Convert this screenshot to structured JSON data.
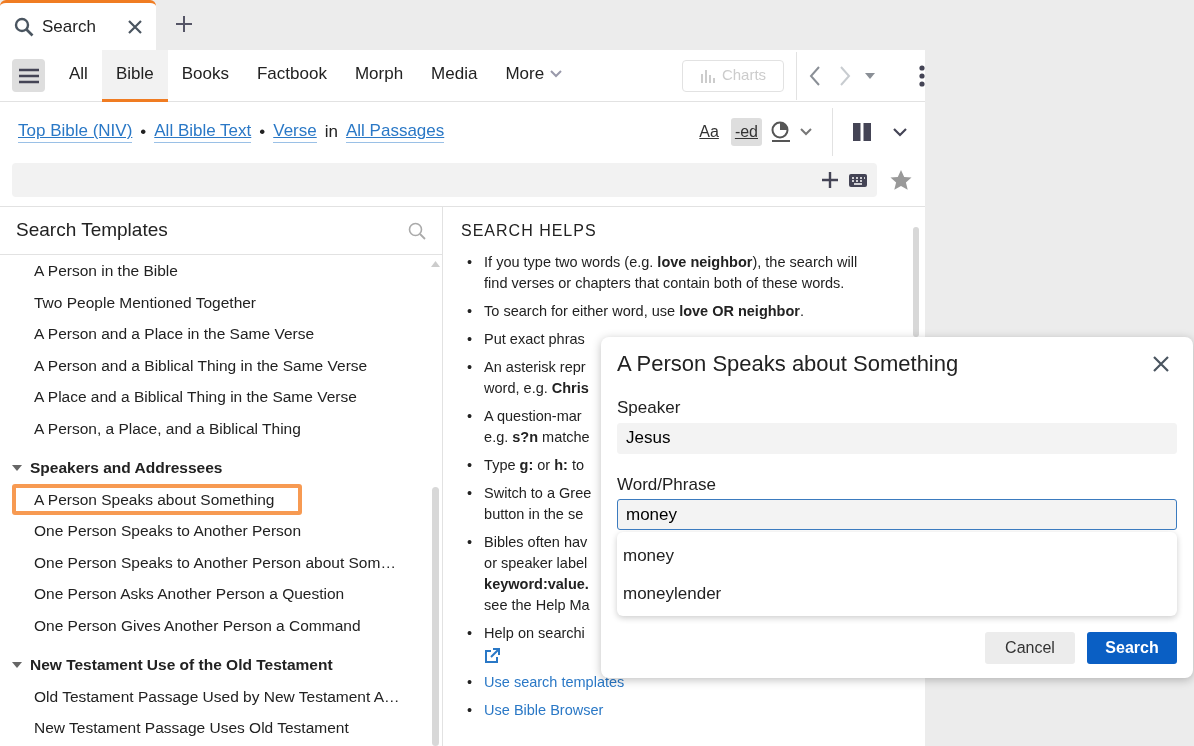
{
  "tab": {
    "label": "Search",
    "selected": true
  },
  "nav_tabs": [
    {
      "label": "All",
      "selected": false
    },
    {
      "label": "Bible",
      "selected": true
    },
    {
      "label": "Books",
      "selected": false
    },
    {
      "label": "Factbook",
      "selected": false
    },
    {
      "label": "Morph",
      "selected": false
    },
    {
      "label": "Media",
      "selected": false
    }
  ],
  "more": {
    "label": "More"
  },
  "charts": {
    "label": "Charts",
    "disabled": true
  },
  "crumbs": [
    {
      "kind": "link",
      "text": "Top Bible (NIV)"
    },
    {
      "kind": "sep",
      "text": "•"
    },
    {
      "kind": "link",
      "text": "All Bible Text"
    },
    {
      "kind": "sep",
      "text": "•"
    },
    {
      "kind": "link",
      "text": "Verse"
    },
    {
      "kind": "word",
      "text": "in"
    },
    {
      "kind": "link",
      "text": "All Passages"
    }
  ],
  "view_buttons": [
    {
      "label": "Aa",
      "selected": false
    },
    {
      "label": "-ed",
      "selected": true
    }
  ],
  "templates_title": "Search Templates",
  "templates": [
    {
      "kind": "item",
      "label": "A Person in the Bible",
      "selected": false
    },
    {
      "kind": "item",
      "label": "Two People Mentioned Together",
      "selected": false
    },
    {
      "kind": "item",
      "label": "A Person and a Place in the Same Verse",
      "selected": false
    },
    {
      "kind": "item",
      "label": "A Person and a Biblical Thing in the Same Verse",
      "selected": false
    },
    {
      "kind": "item",
      "label": "A Place and a Biblical Thing in the Same Verse",
      "selected": false
    },
    {
      "kind": "item",
      "label": "A Person, a Place, and a Biblical Thing",
      "selected": false
    },
    {
      "kind": "group",
      "label": "Speakers and Addressees",
      "expanded": true,
      "children": [
        {
          "kind": "item",
          "label": "A Person Speaks about Something",
          "selected": true
        },
        {
          "kind": "item",
          "label": "One Person Speaks to Another Person",
          "selected": false
        },
        {
          "kind": "item",
          "label": "One Person Speaks to Another Person about Som…",
          "selected": false
        },
        {
          "kind": "item",
          "label": "One Person Asks Another Person a Question",
          "selected": false
        },
        {
          "kind": "item",
          "label": "One Person Gives Another Person a Command",
          "selected": false
        }
      ]
    },
    {
      "kind": "group",
      "label": "New Testament Use of the Old Testament",
      "expanded": true,
      "children": [
        {
          "kind": "item",
          "label": "Old Testament Passage Used by New Testament A…",
          "selected": false
        },
        {
          "kind": "item",
          "label": "New Testament Passage Uses Old Testament",
          "selected": false
        }
      ]
    }
  ],
  "helps_title": "SEARCH HELPS",
  "help_marker": "•",
  "helps": [
    {
      "kind": "text",
      "lines": [
        "If you type two words (e.g. **love neighbor**), the search will",
        "find verses or chapters that contain both of these words."
      ]
    },
    {
      "kind": "text",
      "lines": [
        "To search for either word, use **love OR neighbor**."
      ]
    },
    {
      "kind": "text",
      "lines": [
        "Put exact phras"
      ]
    },
    {
      "kind": "text",
      "lines": [
        "An asterisk repr",
        "word, e.g. **Chris**"
      ]
    },
    {
      "kind": "text",
      "lines": [
        "A question-mar",
        "e.g. **s?n** matche"
      ]
    },
    {
      "kind": "text",
      "lines": [
        "Type **g:** or **h:** to"
      ]
    },
    {
      "kind": "text",
      "lines": [
        "Switch to a Gree",
        "button in the se"
      ]
    },
    {
      "kind": "text",
      "lines": [
        "Bibles often hav",
        "or speaker label",
        "**keyword:value.**",
        "see the Help Ma"
      ]
    },
    {
      "kind": "external",
      "lines": [
        "Help on searchi"
      ]
    },
    {
      "kind": "link",
      "lines": [
        "Use search templates"
      ]
    },
    {
      "kind": "link",
      "lines": [
        "Use Bible Browser"
      ]
    }
  ],
  "dialog": {
    "title": "A Person Speaks about Something",
    "fields": [
      {
        "label": "Speaker",
        "value": "Jesus",
        "focused": false
      },
      {
        "label": "Word/Phrase",
        "value": "money",
        "focused": true
      }
    ],
    "suggestions": [
      "money",
      "moneylender"
    ],
    "buttons": [
      {
        "label": "Cancel",
        "kind": "secondary"
      },
      {
        "label": "Search",
        "kind": "primary"
      }
    ]
  }
}
